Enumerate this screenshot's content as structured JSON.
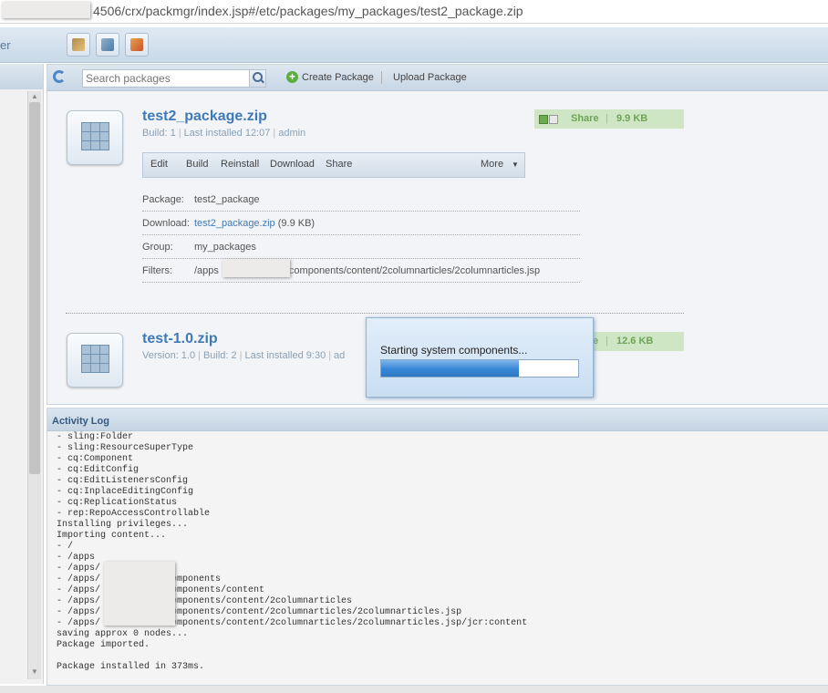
{
  "url": "4506/crx/packmgr/index.jsp#/etc/packages/my_packages/test2_package.zip",
  "app_title": "er",
  "toolbar": {
    "search_placeholder": "Search packages",
    "create_label": "Create Package",
    "upload_label": "Upload Package"
  },
  "packages": [
    {
      "title": "test2_package.zip",
      "meta": {
        "build": "Build: 1",
        "installed": "Last installed 12:07",
        "user": "admin"
      },
      "share": {
        "label": "Share",
        "size": "9.9 KB"
      },
      "actions": [
        "Edit",
        "Build",
        "Reinstall",
        "Download",
        "Share",
        "More"
      ],
      "details": {
        "package_key": "Package:",
        "package_val": "test2_package",
        "download_key": "Download:",
        "download_link": "test2_package.zip",
        "download_size": "(9.9 KB)",
        "group_key": "Group:",
        "group_val": "my_packages",
        "filters_key": "Filters:",
        "filters_prefix": "/apps",
        "filters_suffix": "components/content/2columnarticles/2columnarticles.jsp"
      }
    },
    {
      "title": "test-1.0.zip",
      "meta": {
        "version": "Version: 1.0",
        "build": "Build: 2",
        "installed": "Last installed 9:30",
        "user": "ad"
      },
      "share": {
        "label": "e",
        "size": "12.6 KB"
      }
    }
  ],
  "modal": {
    "text": "Starting system components...",
    "progress": 0.7
  },
  "log": {
    "title": "Activity Log",
    "lines": [
      "- sling:Folder",
      "- sling:ResourceSuperType",
      "- cq:Component",
      "- cq:EditConfig",
      "- cq:EditListenersConfig",
      "- cq:InplaceEditingConfig",
      "- cq:ReplicationStatus",
      "- rep:RepoAccessControllable",
      "Installing privileges...",
      "Importing content...",
      "- /",
      "- /apps",
      "- /apps/",
      "- /apps/           /components",
      "- /apps/           /components/content",
      "- /apps/           /components/content/2columnarticles",
      "- /apps/           /components/content/2columnarticles/2columnarticles.jsp",
      "- /apps/           /components/content/2columnarticles/2columnarticles.jsp/jcr:content",
      "saving approx 0 nodes...",
      "Package imported.",
      "",
      "Package installed in 373ms."
    ]
  },
  "colors": {
    "link": "#3f7ab8",
    "share_green": "#cfe6c4",
    "progress": "#3686d6"
  }
}
